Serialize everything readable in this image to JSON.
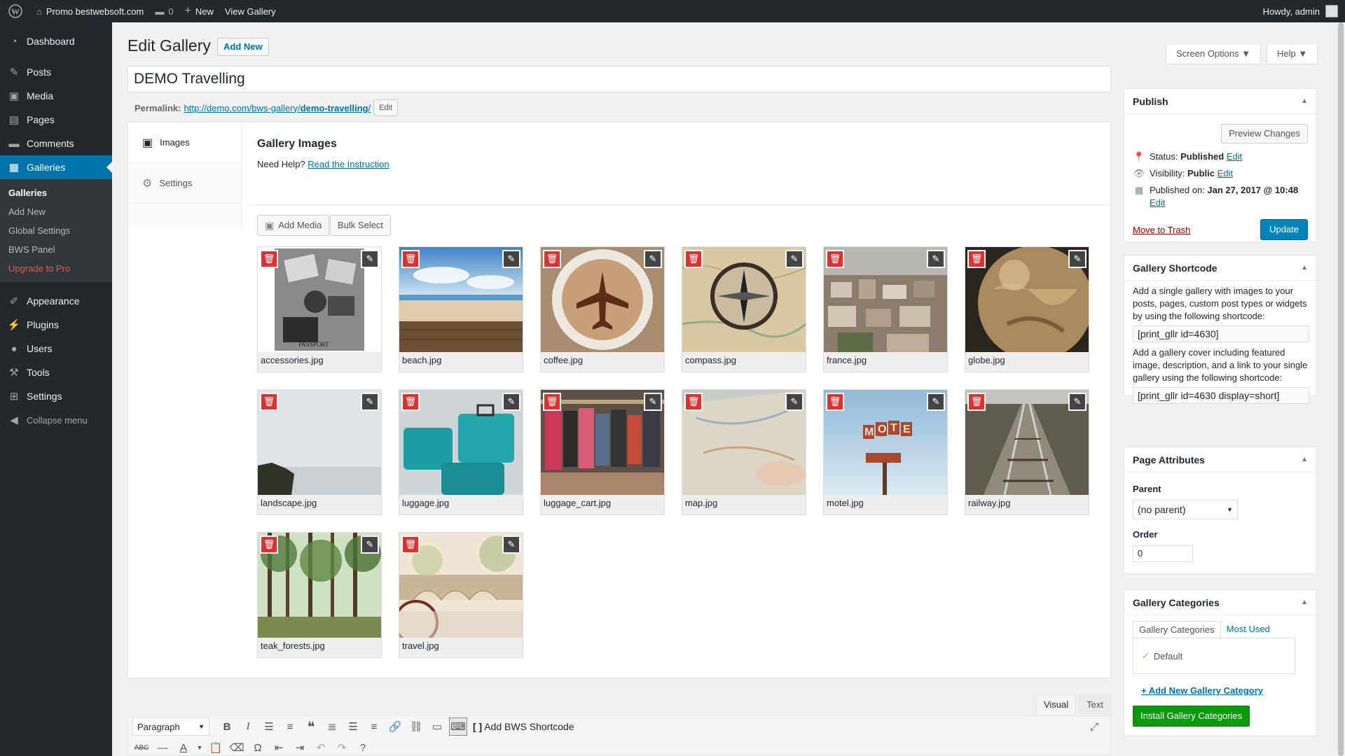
{
  "adminbar": {
    "site_name": "Promo bestwebsoft.com",
    "comments_count": "0",
    "new_label": "New",
    "view_gallery_label": "View Gallery",
    "howdy": "Howdy, admin"
  },
  "sidebar": {
    "dashboard": "Dashboard",
    "posts": "Posts",
    "media": "Media",
    "pages": "Pages",
    "comments": "Comments",
    "galleries": "Galleries",
    "submenu": [
      "Galleries",
      "Add New",
      "Global Settings",
      "BWS Panel",
      "Upgrade to Pro"
    ],
    "appearance": "Appearance",
    "plugins": "Plugins",
    "users": "Users",
    "tools": "Tools",
    "settings": "Settings",
    "collapse": "Collapse menu"
  },
  "header": {
    "title": "Edit Gallery",
    "add_new": "Add New",
    "screen_options": "Screen Options ▼",
    "help": "Help ▼"
  },
  "post": {
    "title": "DEMO Travelling",
    "permalink_label": "Permalink:",
    "permalink_base": "http://demo.com/bws-gallery/",
    "permalink_slug": "demo-travelling",
    "permalink_end": "/",
    "edit_label": "Edit"
  },
  "gallery": {
    "tab_images": "Images",
    "tab_settings": "Settings",
    "title": "Gallery Images",
    "help_text": "Need Help?",
    "help_link": "Read the Instruction",
    "add_media": "Add Media",
    "bulk_select": "Bulk Select",
    "images": [
      "accessories.jpg",
      "beach.jpg",
      "coffee.jpg",
      "compass.jpg",
      "france.jpg",
      "globe.jpg",
      "landscape.jpg",
      "luggage.jpg",
      "luggage_cart.jpg",
      "map.jpg",
      "motel.jpg",
      "railway.jpg",
      "teak_forests.jpg",
      "travel.jpg"
    ]
  },
  "editor": {
    "tab_visual": "Visual",
    "tab_text": "Text",
    "format": "Paragraph",
    "bws_shortcode": "Add BWS Shortcode"
  },
  "publish": {
    "title": "Publish",
    "preview": "Preview Changes",
    "status_label": "Status:",
    "status_value": "Published",
    "visibility_label": "Visibility:",
    "visibility_value": "Public",
    "published_label": "Published on:",
    "published_value": "Jan 27, 2017 @ 10:48",
    "edit": "Edit",
    "trash": "Move to Trash",
    "update": "Update"
  },
  "shortcode_box": {
    "title": "Gallery Shortcode",
    "text1": "Add a single gallery with images to your posts, pages, custom post types or widgets by using the following shortcode:",
    "code1": "[print_gllr id=4630]",
    "text2": "Add a gallery cover including featured image, description, and a link to your single gallery using the following shortcode:",
    "code2": "[print_gllr id=4630 display=short]"
  },
  "attributes": {
    "title": "Page Attributes",
    "parent_label": "Parent",
    "parent_value": "(no parent)",
    "order_label": "Order",
    "order_value": "0"
  },
  "categories": {
    "title": "Gallery Categories",
    "tab_all": "Gallery Categories",
    "tab_used": "Most Used",
    "default": "Default",
    "add_new": "+ Add New Gallery Category",
    "install": "Install Gallery Categories"
  }
}
